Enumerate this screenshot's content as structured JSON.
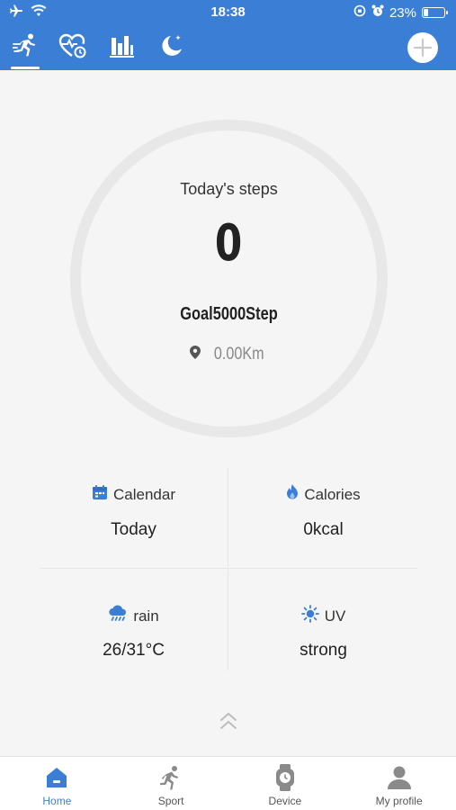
{
  "status_bar": {
    "time": "18:38",
    "battery_percent": "23%",
    "battery_level": 0.23,
    "icons": [
      "airplane-icon",
      "wifi-icon",
      "rotation-lock-icon",
      "alarm-icon",
      "battery-icon"
    ]
  },
  "top_tabs": [
    {
      "name": "run-icon",
      "active": true
    },
    {
      "name": "heart-rate-icon",
      "active": false
    },
    {
      "name": "bar-chart-icon",
      "active": false
    },
    {
      "name": "sleep-moon-icon",
      "active": false
    }
  ],
  "colors": {
    "header": "#3a7fd5",
    "accent": "#3a7fd5",
    "ring": "#e8e8e8"
  },
  "steps": {
    "title": "Today's steps",
    "count": "0",
    "goal": "Goal5000Step",
    "distance": "0.00Km"
  },
  "stats": {
    "calendar": {
      "label": "Calendar",
      "value": "Today"
    },
    "calories": {
      "label": "Calories",
      "value": "0kcal"
    },
    "weather": {
      "label": "rain",
      "value": "26/31°C"
    },
    "uv": {
      "label": "UV",
      "value": "strong"
    }
  },
  "bottom_nav": {
    "home": "Home",
    "sport": "Sport",
    "device": "Device",
    "profile": "My profile"
  }
}
